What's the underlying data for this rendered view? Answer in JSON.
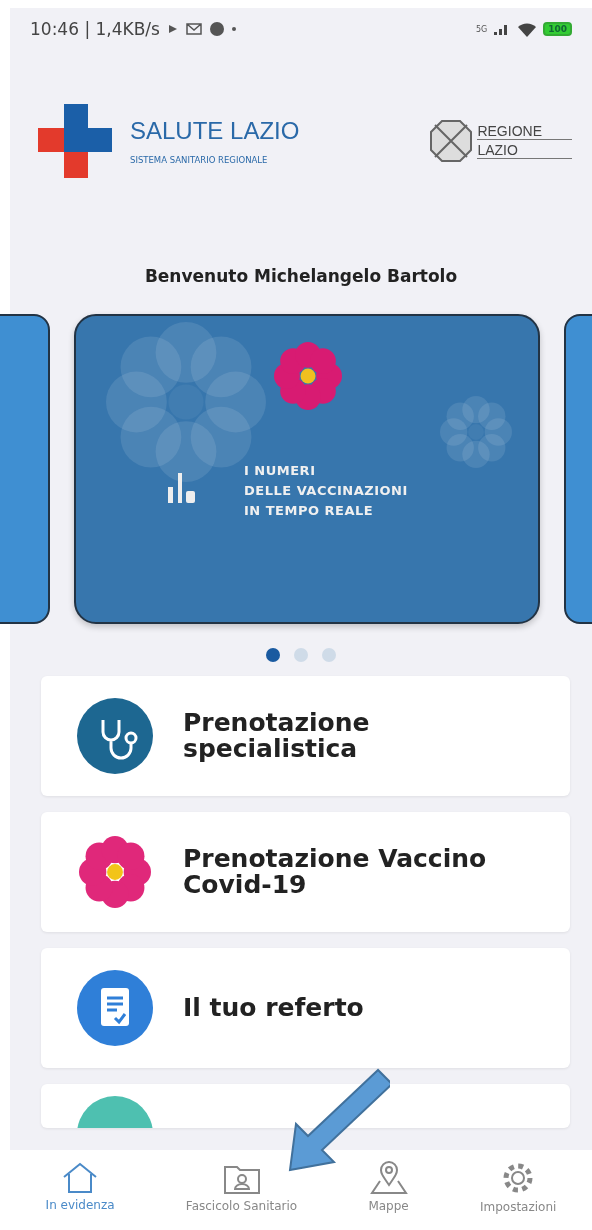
{
  "status_bar": {
    "time": "10:46 | 1,4KB/s",
    "network": "5G",
    "battery": "100"
  },
  "header": {
    "brand_title": "SALUTE LAZIO",
    "brand_subtitle": "SISTEMA SANITARIO REGIONALE",
    "partner_line_1": "REGIONE",
    "partner_line_2": "LAZIO"
  },
  "welcome": "Benvenuto Michelangelo Bartolo",
  "carousel": {
    "banner_text": "I NUMERI\nDELLE VACCINAZIONI\nIN TEMPO REALE",
    "dots": [
      {
        "selected": true
      },
      {
        "selected": false
      },
      {
        "selected": false
      }
    ]
  },
  "menu": [
    {
      "kind": "stethoscope",
      "title": "Prenotazione\nspecialistica"
    },
    {
      "kind": "flower",
      "title": "Prenotazione Vaccino\nCovid-19"
    },
    {
      "kind": "document",
      "title": "Il tuo referto"
    },
    {
      "kind": "partial"
    }
  ],
  "nav": [
    {
      "kind": "home",
      "label": "In evidenza",
      "selected": true
    },
    {
      "kind": "folder",
      "label": "Fascicolo Sanitario",
      "selected": false
    },
    {
      "kind": "map",
      "label": "Mappe",
      "selected": false
    },
    {
      "kind": "gear",
      "label": "Impostazioni",
      "selected": false
    }
  ]
}
